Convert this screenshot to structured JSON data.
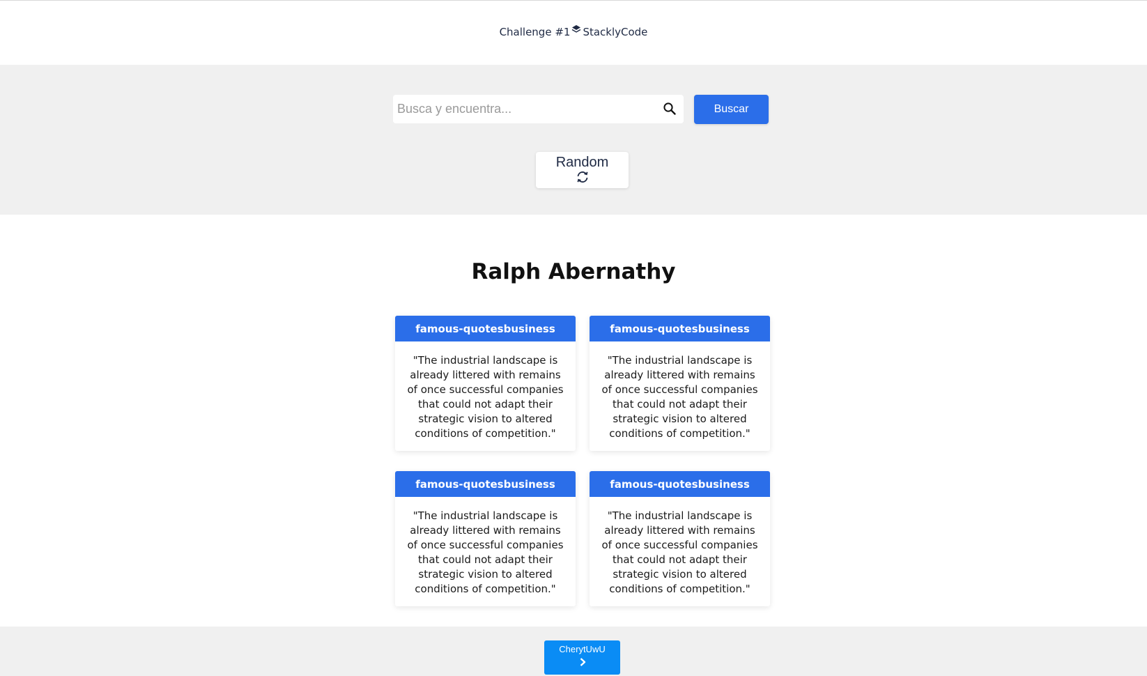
{
  "header": {
    "brand_prefix": "Challenge #1",
    "brand_name": "StacklyCode",
    "logo_icon": "layers-icon"
  },
  "search": {
    "placeholder": "Busca y encuentra...",
    "value": "",
    "icon": "search-icon",
    "button_label": "Buscar"
  },
  "random": {
    "label": "Random",
    "icon": "refresh-icon"
  },
  "main": {
    "author": "Ralph Abernathy",
    "quotes": [
      {
        "tag": "famous-quotesbusiness",
        "text": "\"The industrial landscape is already littered with remains of once successful companies that could not adapt their strategic vision to altered conditions of competition.\""
      },
      {
        "tag": "famous-quotesbusiness",
        "text": "\"The industrial landscape is already littered with remains of once successful companies that could not adapt their strategic vision to altered conditions of competition.\""
      },
      {
        "tag": "famous-quotesbusiness",
        "text": "\"The industrial landscape is already littered with remains of once successful companies that could not adapt their strategic vision to altered conditions of competition.\""
      },
      {
        "tag": "famous-quotesbusiness",
        "text": "\"The industrial landscape is already littered with remains of once successful companies that could not adapt their strategic vision to altered conditions of competition.\""
      }
    ]
  },
  "footer": {
    "button_label": "CherytUwU",
    "icon": "chevron-right-icon"
  },
  "colors": {
    "accent": "#2b6ee9",
    "footer_button": "#0a8cf5",
    "band_background": "#f0f0f0",
    "text_dark": "#1f2a44"
  }
}
